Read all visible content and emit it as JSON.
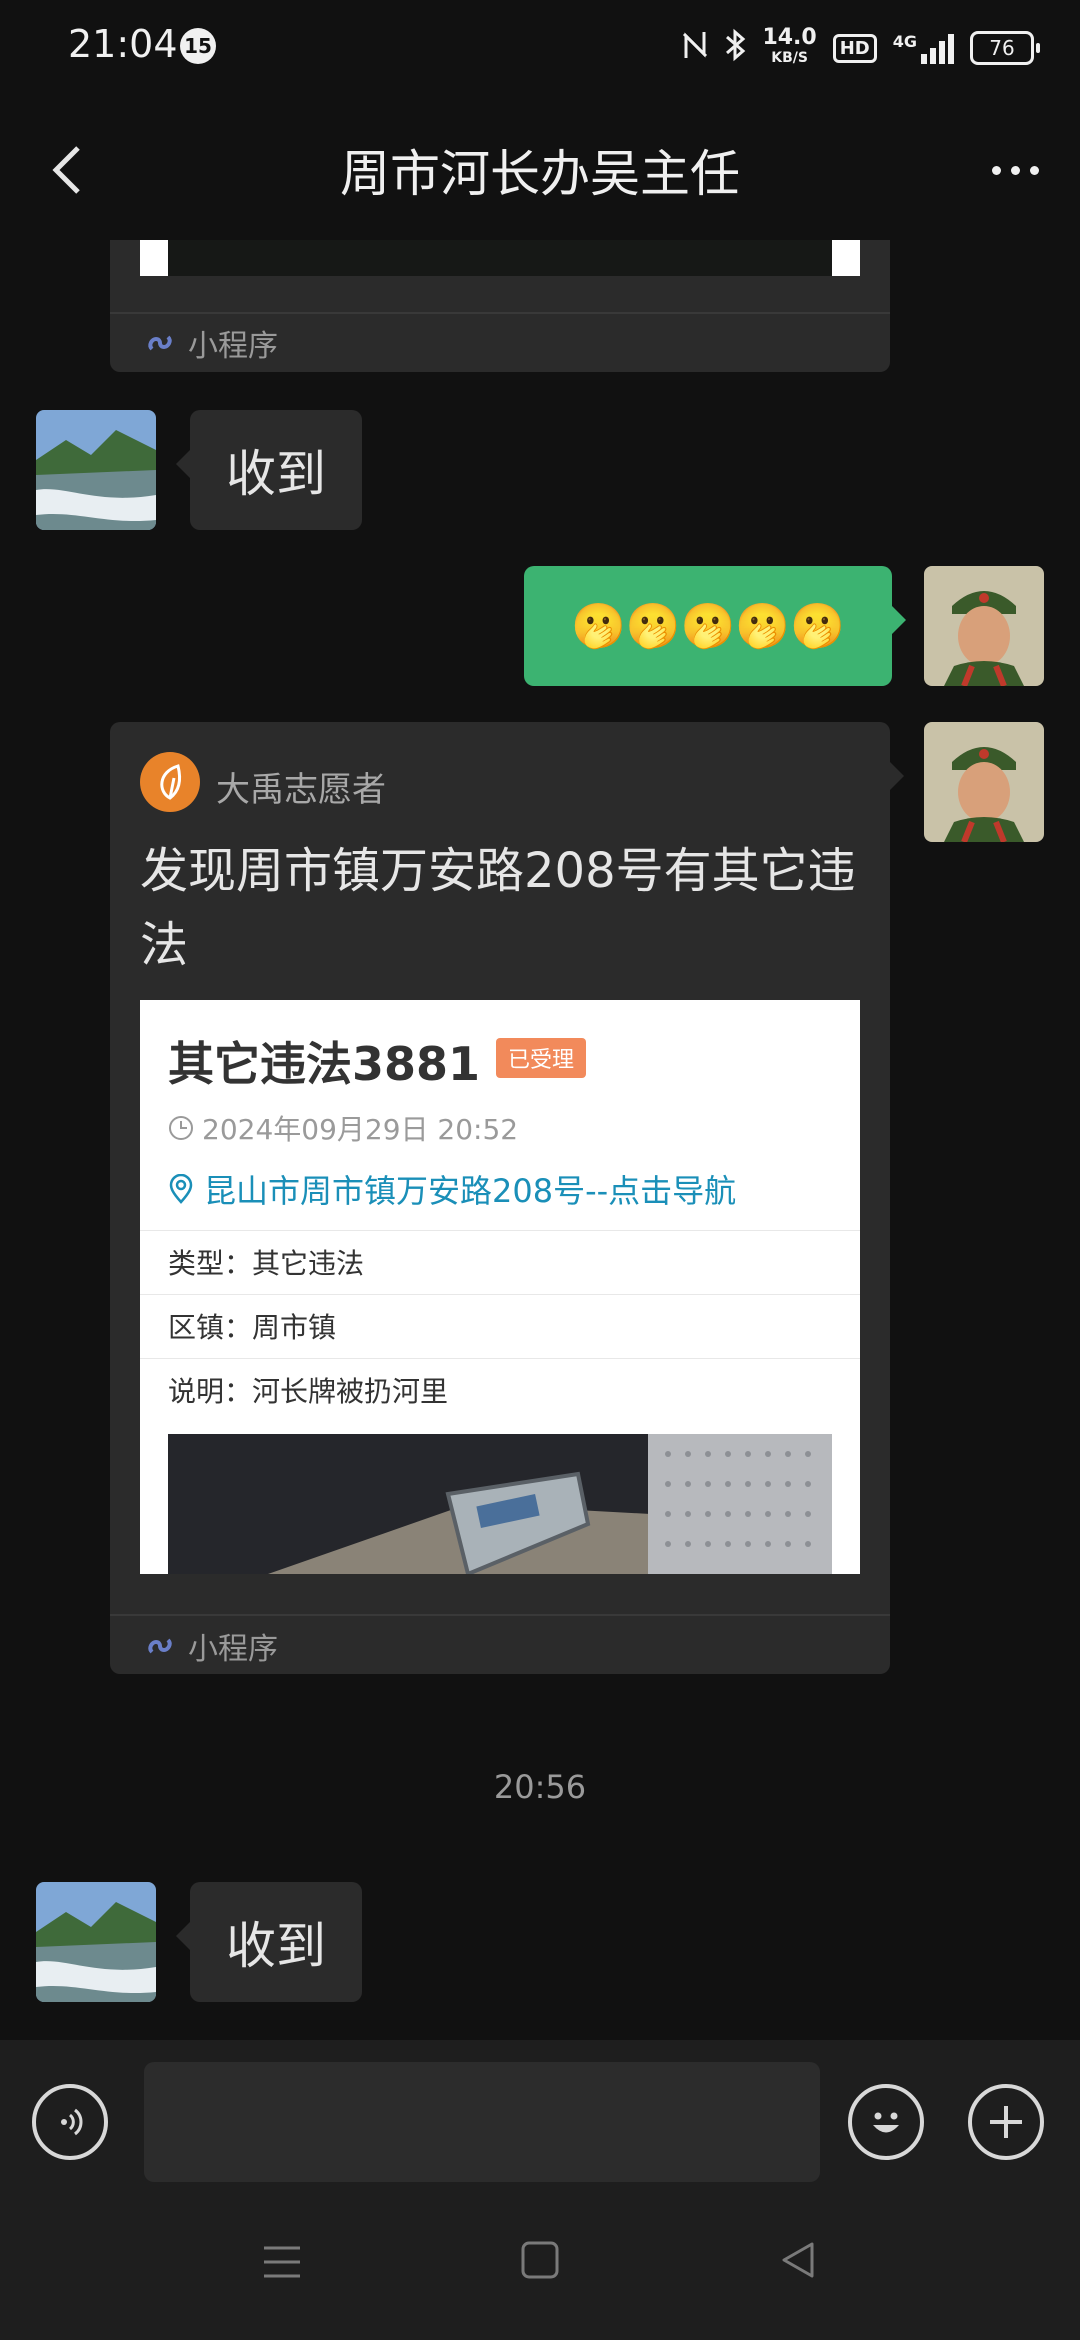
{
  "status_bar": {
    "time": "21:04",
    "notification_count": "15",
    "net_speed": "14.0",
    "net_speed_unit": "KB/S",
    "hd_label": "HD",
    "network_type": "4G",
    "battery": "76"
  },
  "header": {
    "title": "周市河长办吴主任"
  },
  "messages": {
    "top_card_footer": "小程序",
    "reply_1": "收到",
    "emoji_message": "🫢🫢🫢🫢🫢",
    "mini_program": {
      "app_name": "大禹志愿者",
      "title": "发现周市镇万安路208号有其它违法",
      "report_title": "其它违法3881",
      "status_tag": "已受理",
      "datetime": "2024年09月29日 20:52",
      "location": "昆山市周市镇万安路208号--点击导航",
      "rows": [
        {
          "label": "类型：",
          "value": "其它违法"
        },
        {
          "label": "区镇：",
          "value": "周市镇"
        },
        {
          "label": "说明：",
          "value": "河长牌被扔河里"
        }
      ],
      "footer": "小程序"
    },
    "time_separator": "20:56",
    "reply_2": "收到"
  },
  "colors": {
    "background": "#111111",
    "bubble_out": "#3cb371",
    "bubble_in": "#2b2b2b",
    "status_tag": "#f28a5b",
    "location_link": "#1a8fb8"
  },
  "icons": [
    "back-arrow-icon",
    "more-icon",
    "link-icon",
    "clock-icon",
    "location-pin-icon",
    "voice-icon",
    "emoji-icon",
    "plus-icon",
    "menu-icon",
    "home-icon",
    "back-triangle-icon"
  ]
}
